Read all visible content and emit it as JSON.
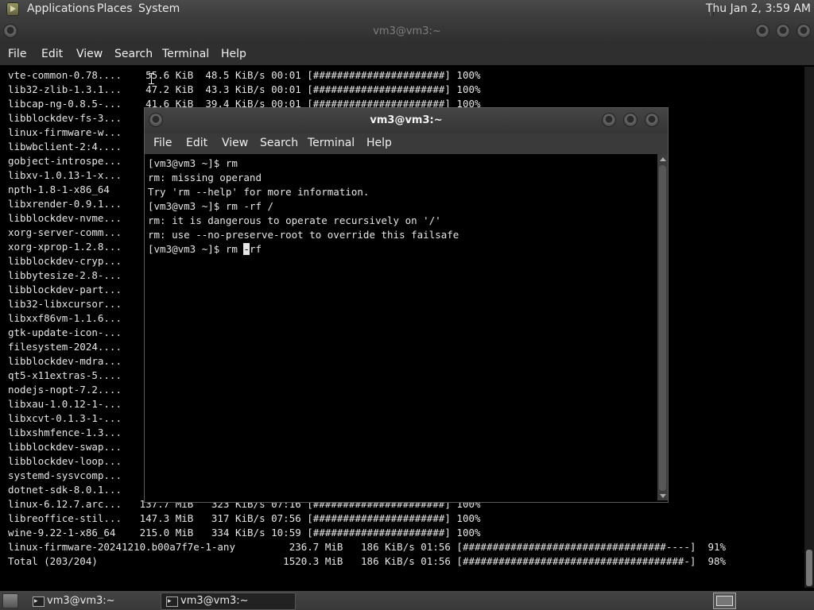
{
  "top_panel": {
    "menus": [
      "Applications",
      "Places",
      "System"
    ],
    "clock": "Thu Jan  2,  3:59 AM"
  },
  "bg_terminal": {
    "title": "vm3@vm3:~",
    "menus": [
      "File",
      "Edit",
      "View",
      "Search",
      "Terminal",
      "Help"
    ],
    "lines": [
      "vte-common-0.78....    55.6 KiB  48.5 KiB/s 00:01 [######################] 100%",
      "lib32-zlib-1.3.1...    47.2 KiB  43.3 KiB/s 00:01 [######################] 100%",
      "libcap-ng-0.8.5-...    41.6 KiB  39.4 KiB/s 00:01 [######################] 100%",
      "libblockdev-fs-3...",
      "linux-firmware-w...",
      "libwbclient-2:4....",
      "gobject-introspe...",
      "libxv-1.0.13-1-x...",
      "npth-1.8-1-x86_64",
      "libxrender-0.9.1...",
      "libblockdev-nvme...",
      "xorg-server-comm...",
      "xorg-xprop-1.2.8...",
      "libblockdev-cryp...",
      "libbytesize-2.8-...",
      "libblockdev-part...",
      "lib32-libxcursor...",
      "libxxf86vm-1.1.6...",
      "gtk-update-icon-...",
      "filesystem-2024....",
      "libblockdev-mdra...",
      "qt5-x11extras-5....",
      "nodejs-nopt-7.2....",
      "libxau-1.0.12-1-...",
      "libxcvt-0.1.3-1-...",
      "libxshmfence-1.3...",
      "libblockdev-swap...",
      "libblockdev-loop...",
      "systemd-sysvcomp...",
      "dotnet-sdk-8.0.1...",
      "linux-6.12.7.arc...   137.7 MiB   323 KiB/s 07:16 [######################] 100%",
      "libreoffice-stil...   147.3 MiB   317 KiB/s 07:56 [######################] 100%",
      "wine-9.22-1-x86_64    215.0 MiB   334 KiB/s 10:59 [######################] 100%",
      "linux-firmware-20241210.b00a7f7e-1-any         236.7 MiB   186 KiB/s 01:56 [##################################----]  91%",
      "Total (203/204)                               1520.3 MiB   186 KiB/s 01:56 [#####################################-]  98%"
    ]
  },
  "fg_terminal": {
    "title": "vm3@vm3:~",
    "menus": [
      "File",
      "Edit",
      "View",
      "Search",
      "Terminal",
      "Help"
    ],
    "lines": [
      "[vm3@vm3 ~]$ rm",
      "rm: missing operand",
      "Try 'rm --help' for more information.",
      "[vm3@vm3 ~]$ rm -rf /",
      "rm: it is dangerous to operate recursively on '/'",
      "rm: use --no-preserve-root to override this failsafe"
    ],
    "prompt": "[vm3@vm3 ~]$ rm ",
    "cursor_char": "-",
    "after_cursor": "-rf"
  },
  "taskbar": {
    "tasks": [
      "vm3@vm3:~",
      "vm3@vm3:~"
    ]
  }
}
